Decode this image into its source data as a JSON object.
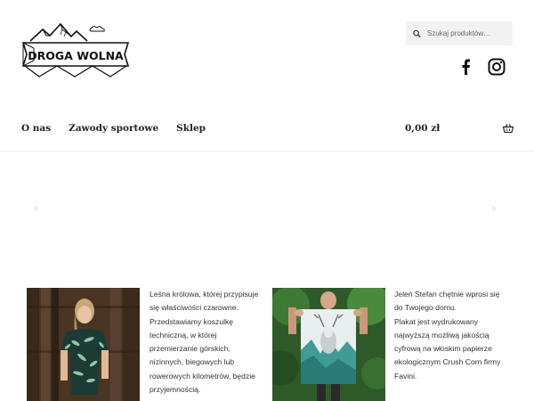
{
  "header": {
    "logo_text": "DROGA WOLNA",
    "search": {
      "placeholder": "Szukaj produktów…",
      "value": ""
    },
    "social": [
      {
        "icon": "facebook-icon",
        "label": "f"
      },
      {
        "icon": "instagram-icon"
      }
    ]
  },
  "nav": {
    "items": [
      {
        "label": "O nas"
      },
      {
        "label": "Zawody sportowe"
      },
      {
        "label": "Sklep"
      }
    ]
  },
  "cart": {
    "amount": "0,00 zł",
    "icon": "basket-icon"
  },
  "slider": {
    "prev": "‹",
    "next": "›"
  },
  "promos": [
    {
      "image": "woman-in-leaf-print-shirt",
      "lines": [
        "Leśna królowa, której przypisuje",
        "się właściwości czarowne.",
        "Przedstawiamy koszulkę",
        "techniczną, w której",
        "przemierzanie górskich,",
        "nizinnych, biegowych lub",
        "rowerowych kilometrów, będzie",
        "przyjemnością."
      ]
    },
    {
      "image": "man-holding-deer-poster",
      "lines": [
        "Jeleń Stefan chętnie wprosi się",
        "do Twojego domu.",
        "Plakat jest wydrukowany",
        "najwyższą możliwą jakością",
        "cyfrową na włoskim papierze",
        "ekologicznym Crush Corn firmy",
        "Favini."
      ]
    }
  ],
  "colors": {
    "nav_text": "#222222",
    "search_bg": "#f2f2f2",
    "divider": "#ececec"
  }
}
